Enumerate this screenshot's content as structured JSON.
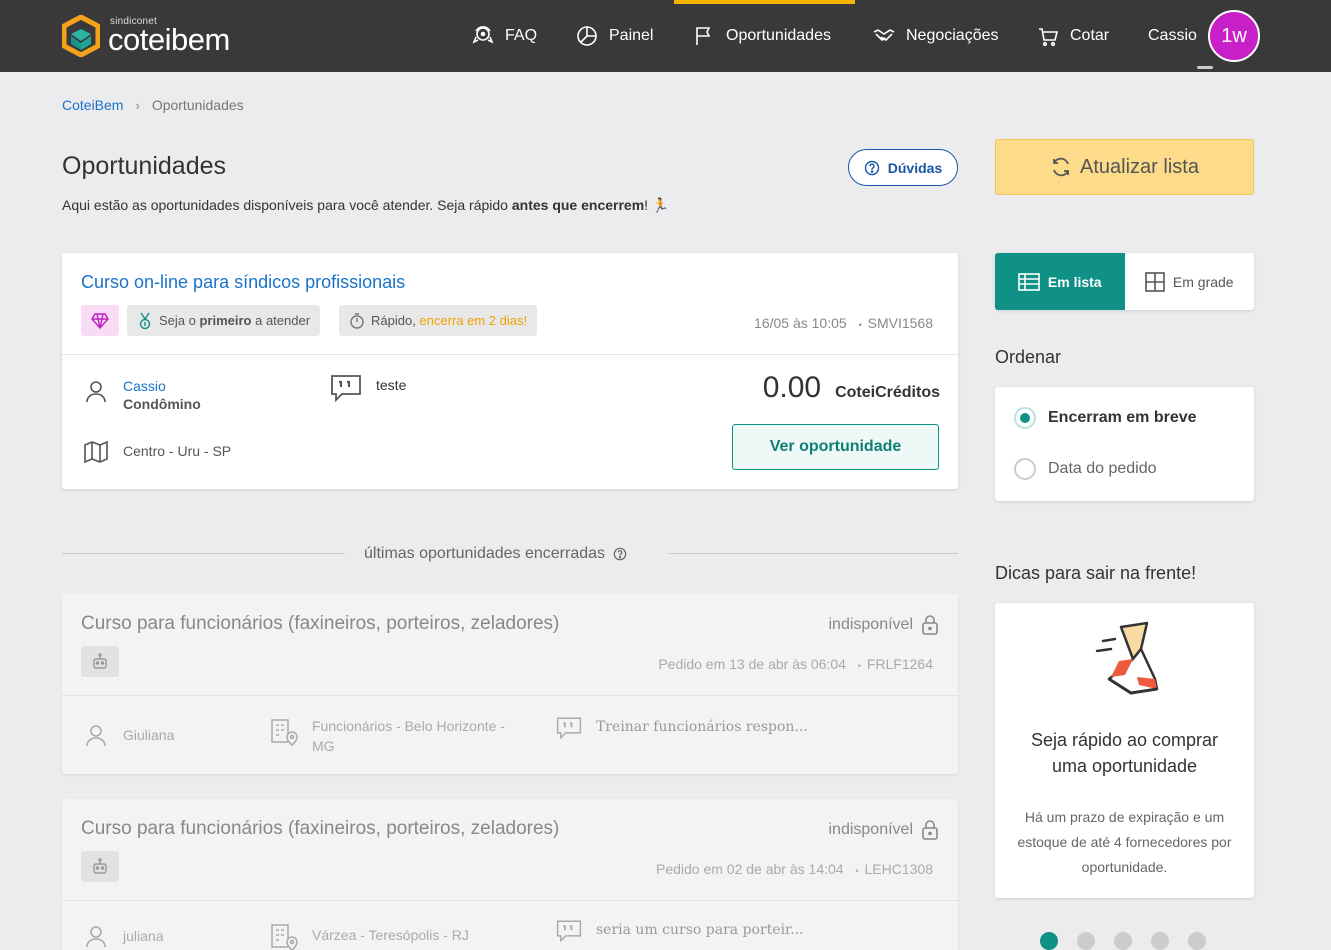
{
  "nav": {
    "brand_small": "sindiconet",
    "brand_big": "coteibem",
    "items": [
      {
        "label": "FAQ",
        "icon": "faq-icon"
      },
      {
        "label": "Painel",
        "icon": "pie-chart-icon"
      },
      {
        "label": "Oportunidades",
        "icon": "flag-icon"
      },
      {
        "label": "Negociações",
        "icon": "handshake-icon"
      },
      {
        "label": "Cotar",
        "icon": "cart-icon"
      }
    ],
    "active_item": "Oportunidades",
    "user_name": "Cassio",
    "avatar_initials": "1w"
  },
  "breadcrumb": {
    "home": "CoteiBem",
    "current": "Oportunidades"
  },
  "page": {
    "title": "Oportunidades",
    "subtitle_prefix": "Aqui estão as oportunidades disponíveis para você atender. Seja rápido ",
    "subtitle_bold": "antes que encerrem",
    "subtitle_suffix": "! 🏃",
    "duvidas_label": "Dúvidas"
  },
  "active_opportunity": {
    "title": "Curso on-line para síndicos profissionais",
    "tag_first_pre": "Seja o ",
    "tag_first_bold": "primeiro",
    "tag_first_post": " a atender",
    "tag_fast_pre": "Rápido, ",
    "tag_fast_highlight": "encerra em 2 dias!",
    "date": "16/05 às 10:05",
    "code": "SMVI1568",
    "requester_name": "Cassio",
    "requester_role": "Condômino",
    "location": "Centro - Uru - SP",
    "description": "teste",
    "credits_value": "0.00",
    "credits_unit": "CoteiCréditos",
    "button_label": "Ver oportunidade"
  },
  "closed_section": {
    "label": "últimas oportunidades encerradas",
    "items": [
      {
        "title": "Curso para funcionários (faxineiros, porteiros, zeladores)",
        "status": "indisponível",
        "meta": "Pedido em 13 de abr às 06:04",
        "code": "FRLF1264",
        "requester": "Giuliana",
        "place_line1": "Funcionários - Belo Horizonte -",
        "place_line2": "MG",
        "description": "Treinar funcionários respon..."
      },
      {
        "title": "Curso para funcionários (faxineiros, porteiros, zeladores)",
        "status": "indisponível",
        "meta": "Pedido em 02 de abr às 14:04",
        "code": "LEHC1308",
        "requester": "juliana",
        "place_line1": "Várzea - Teresópolis - RJ",
        "place_line2": "",
        "description": "seria um curso para porteir..."
      }
    ]
  },
  "sidebar": {
    "refresh_label": "Atualizar lista",
    "view_list_label": "Em lista",
    "view_grid_label": "Em grade",
    "sort_heading": "Ordenar",
    "sort_options": [
      {
        "label": "Encerram em breve",
        "selected": true
      },
      {
        "label": "Data do pedido",
        "selected": false
      }
    ],
    "tips_heading": "Dicas para sair na frente!",
    "tip_title": "Seja rápido ao comprar uma oportunidade",
    "tip_text": "Há um prazo de expiração e um estoque de até 4 fornecedores por oportunidade.",
    "carousel_dots": 5,
    "carousel_active": 1
  },
  "colors": {
    "nav_bg": "#393939",
    "accent_teal": "#0f9186",
    "accent_yellow": "#f5b400",
    "link_blue": "#1a73c9",
    "avatar_magenta": "#c820c8"
  }
}
